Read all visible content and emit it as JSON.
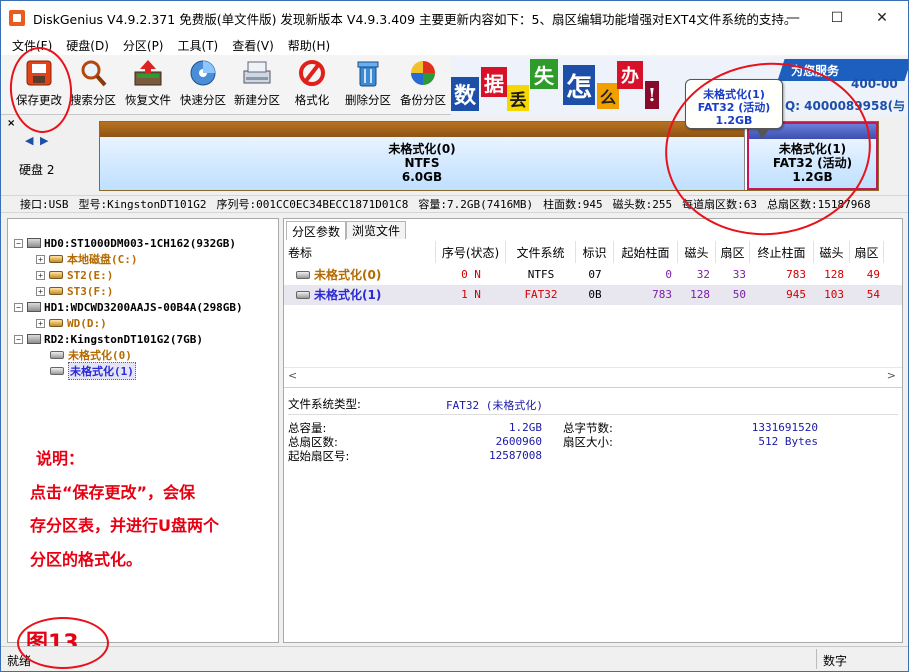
{
  "window": {
    "title": "DiskGenius V4.9.2.371 免费版(单文件版)    发现新版本 V4.9.3.409 主要更新内容如下：5、扇区编辑功能增强对EXT4文件系统的支持。",
    "controls": [
      "—",
      "☐",
      "✕"
    ]
  },
  "menu": [
    "文件(F)",
    "硬盘(D)",
    "分区(P)",
    "工具(T)",
    "查看(V)",
    "帮助(H)"
  ],
  "toolbar": [
    {
      "label": "保存更改",
      "icon": "save-icon"
    },
    {
      "label": "搜索分区",
      "icon": "search-icon"
    },
    {
      "label": "恢复文件",
      "icon": "recover-icon"
    },
    {
      "label": "快速分区",
      "icon": "quick-partition-icon"
    },
    {
      "label": "新建分区",
      "icon": "new-partition-icon"
    },
    {
      "label": "格式化",
      "icon": "format-icon"
    },
    {
      "label": "删除分区",
      "icon": "delete-icon"
    },
    {
      "label": "备份分区",
      "icon": "backup-icon"
    }
  ],
  "ad": {
    "tiles": [
      "数",
      "据",
      "丢",
      "失",
      "怎",
      "么",
      "办",
      "!"
    ],
    "slogan": "为您服务",
    "phone_partial": "400-00",
    "qq": "Q: 4000089958(与"
  },
  "disk_panel": {
    "disk_label": "硬盘 2",
    "nav_prev": "◀",
    "nav_next": "▶",
    "partitions": [
      {
        "name": "未格式化(0)",
        "fs": "NTFS",
        "size": "6.0GB"
      },
      {
        "name": "未格式化(1)",
        "fs": "FAT32 (活动)",
        "size": "1.2GB"
      }
    ],
    "tooltip": {
      "name": "未格式化(1)",
      "fs": "FAT32 (活动)",
      "size": "1.2GB"
    }
  },
  "infobar": [
    "接口:USB",
    "型号:KingstonDT101G2",
    "序列号:001CC0EC34BECC1871D01C8",
    "容量:7.2GB(7416MB)",
    "柱面数:945",
    "磁头数:255",
    "每道扇区数:63",
    "总扇区数:15187968"
  ],
  "tree": {
    "nodes": [
      {
        "label": "HD0:ST1000DM003-1CH162(932GB)"
      },
      {
        "label": "本地磁盘(C:)"
      },
      {
        "label": "ST2(E:)"
      },
      {
        "label": "ST3(F:)"
      },
      {
        "label": "HD1:WDCWD3200AAJS-00B4A(298GB)"
      },
      {
        "label": "WD(D:)"
      },
      {
        "label": "RD2:KingstonDT101G2(7GB)"
      },
      {
        "label": "未格式化(0)"
      },
      {
        "label": "未格式化(1)"
      }
    ]
  },
  "note": {
    "line1": "说明：",
    "line2": "点击“保存更改”，会保",
    "line3": "存分区表，并进行U盘两个",
    "line4": "分区的格式化。",
    "figure": "图13"
  },
  "tabs": [
    "分区参数",
    "浏览文件"
  ],
  "table": {
    "headers": [
      "卷标",
      "序号(状态)",
      "文件系统",
      "标识",
      "起始柱面",
      "磁头",
      "扇区",
      "终止柱面",
      "磁头",
      "扇区"
    ],
    "rows": [
      [
        "未格式化(0)",
        "0 N",
        "NTFS",
        "07",
        "0",
        "32",
        "33",
        "783",
        "128",
        "49"
      ],
      [
        "未格式化(1)",
        "1 N",
        "FAT32",
        "0B",
        "783",
        "128",
        "50",
        "945",
        "103",
        "54"
      ]
    ]
  },
  "details": {
    "fs_type_label": "文件系统类型:",
    "fs_type_value": "FAT32 (未格式化)",
    "total_capacity_label": "总容量:",
    "total_capacity_value": "1.2GB",
    "total_bytes_label": "总字节数:",
    "total_bytes_value": "1331691520",
    "total_sectors_label": "总扇区数:",
    "total_sectors_value": "2600960",
    "sector_size_label": "扇区大小:",
    "sector_size_value": "512 Bytes",
    "start_sector_label": "起始扇区号:",
    "start_sector_value": "12587008"
  },
  "status": {
    "left": "就绪",
    "right": "数字"
  },
  "colors": {
    "red": "#e60012",
    "blue_text": "#1a3cc8",
    "orange_text": "#b46a00",
    "selected_row": "#e8e6ee",
    "red_value": "#d40000",
    "purple_value": "#7a1fa6"
  }
}
